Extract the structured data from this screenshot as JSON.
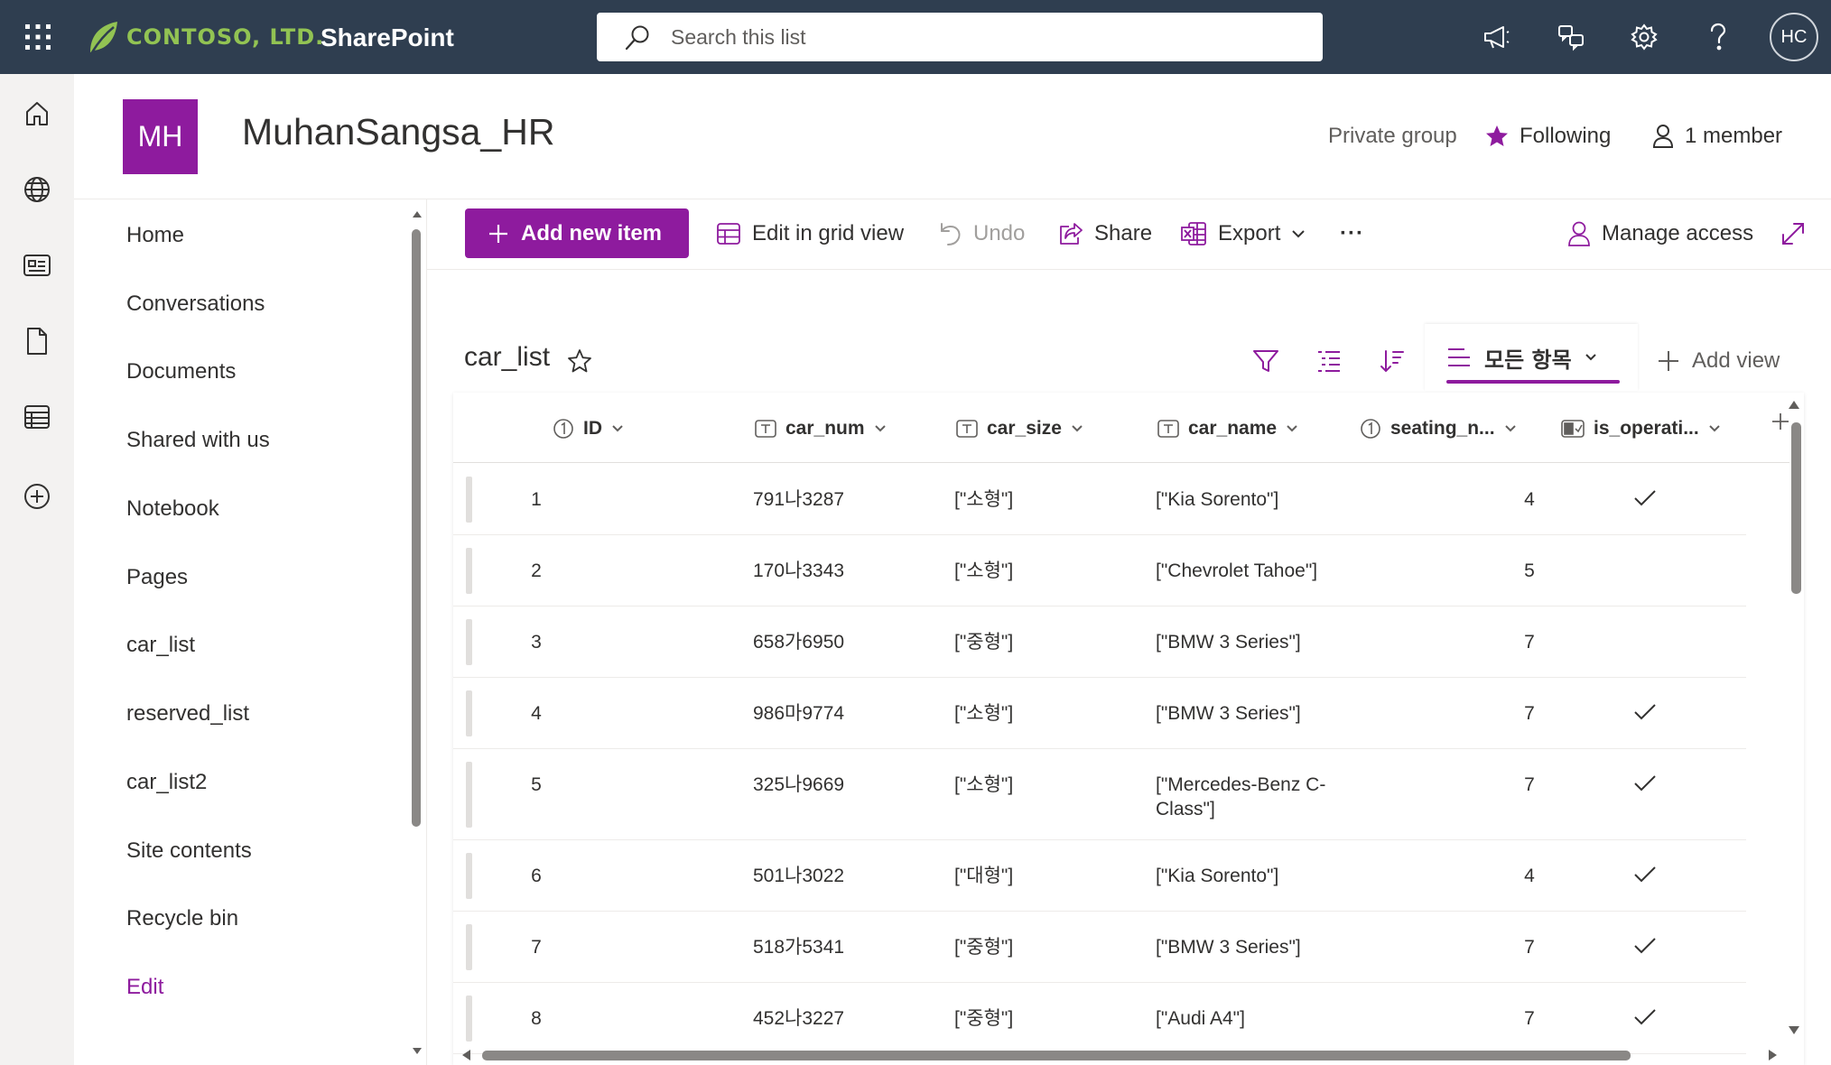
{
  "suite": {
    "brand": "CONTOSO, LTD.",
    "app": "SharePoint",
    "search_placeholder": "Search this list",
    "avatar_initials": "HC"
  },
  "site": {
    "logo_initials": "MH",
    "title": "MuhanSangsa_HR",
    "privacy": "Private group",
    "following": "Following",
    "members": "1 member"
  },
  "nav": {
    "items": [
      "Home",
      "Conversations",
      "Documents",
      "Shared with us",
      "Notebook",
      "Pages",
      "car_list",
      "reserved_list",
      "car_list2",
      "Site contents",
      "Recycle bin"
    ],
    "edit": "Edit"
  },
  "commands": {
    "add_new": "Add new item",
    "grid_view": "Edit in grid view",
    "undo": "Undo",
    "share": "Share",
    "export": "Export",
    "more": "···",
    "manage_access": "Manage access"
  },
  "list": {
    "title": "car_list",
    "view_name": "모든 항목",
    "add_view": "Add view",
    "columns": [
      "ID",
      "car_num",
      "car_size",
      "car_name",
      "seating_n...",
      "is_operati..."
    ],
    "rows": [
      {
        "id": "1",
        "car_num": "791나3287",
        "car_size": "[\"소형\"]",
        "car_name": "[\"Kia Sorento\"]",
        "seating": "4",
        "operating": true
      },
      {
        "id": "2",
        "car_num": "170나3343",
        "car_size": "[\"소형\"]",
        "car_name": "[\"Chevrolet Tahoe\"]",
        "seating": "5",
        "operating": false
      },
      {
        "id": "3",
        "car_num": "658가6950",
        "car_size": "[\"중형\"]",
        "car_name": "[\"BMW 3 Series\"]",
        "seating": "7",
        "operating": false
      },
      {
        "id": "4",
        "car_num": "986마9774",
        "car_size": "[\"소형\"]",
        "car_name": "[\"BMW 3 Series\"]",
        "seating": "7",
        "operating": true
      },
      {
        "id": "5",
        "car_num": "325나9669",
        "car_size": "[\"소형\"]",
        "car_name": "[\"Mercedes-Benz C-Class\"]",
        "seating": "7",
        "operating": true
      },
      {
        "id": "6",
        "car_num": "501나3022",
        "car_size": "[\"대형\"]",
        "car_name": "[\"Kia Sorento\"]",
        "seating": "4",
        "operating": true
      },
      {
        "id": "7",
        "car_num": "518가5341",
        "car_size": "[\"중형\"]",
        "car_name": "[\"BMW 3 Series\"]",
        "seating": "7",
        "operating": true
      },
      {
        "id": "8",
        "car_num": "452나3227",
        "car_size": "[\"중형\"]",
        "car_name": "[\"Audi A4\"]",
        "seating": "7",
        "operating": true
      }
    ]
  },
  "colors": {
    "suitebar": "#2f3e50",
    "accent": "#8e1b9e",
    "brand_green": "#92c353"
  }
}
